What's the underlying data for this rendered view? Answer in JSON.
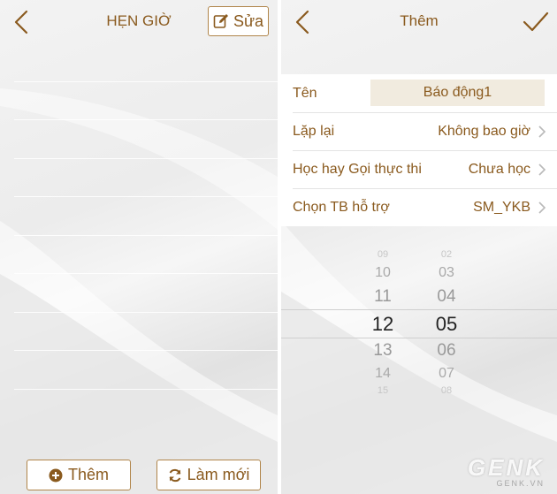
{
  "left_screen": {
    "title": "HẸN GIỜ",
    "edit_label": "Sửa",
    "add_label": "Thêm",
    "refresh_label": "Làm mới"
  },
  "right_screen": {
    "title": "Thêm",
    "rows": [
      {
        "label": "Tên",
        "value": "Báo động1"
      },
      {
        "label": "Lặp lại",
        "value": "Không bao giờ"
      },
      {
        "label": "Học hay Gọi thực thi",
        "value": "Chưa học"
      },
      {
        "label": "Chọn TB hỗ trợ",
        "value": "SM_YKB"
      }
    ],
    "picker": {
      "hours": [
        "09",
        "10",
        "11",
        "12",
        "13",
        "14",
        "15"
      ],
      "minutes": [
        "02",
        "03",
        "04",
        "05",
        "06",
        "07",
        "08"
      ],
      "selected_hour": "12",
      "selected_minute": "05"
    }
  },
  "watermark": {
    "main": "GENK",
    "sub": "GENK.VN"
  },
  "colors": {
    "accent": "#8a5a1e",
    "button_border": "#b0854a",
    "name_field_bg": "#f1ebdf"
  },
  "icons": [
    "back-arrow-icon",
    "edit-icon",
    "checkmark-icon",
    "chevron-right-icon",
    "plus-circle-icon",
    "refresh-icon"
  ]
}
